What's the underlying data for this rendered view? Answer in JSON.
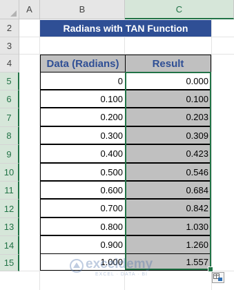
{
  "columns": [
    "A",
    "B",
    "C"
  ],
  "rows": [
    "2",
    "3",
    "4",
    "5",
    "6",
    "7",
    "8",
    "9",
    "10",
    "11",
    "12",
    "13",
    "14",
    "15"
  ],
  "title": "Radians with TAN Function",
  "table": {
    "headers": [
      "Data (Radians)",
      "Result"
    ],
    "rows": [
      {
        "data": "0",
        "result": "0.000"
      },
      {
        "data": "0.100",
        "result": "0.100"
      },
      {
        "data": "0.200",
        "result": "0.203"
      },
      {
        "data": "0.300",
        "result": "0.309"
      },
      {
        "data": "0.400",
        "result": "0.423"
      },
      {
        "data": "0.500",
        "result": "0.546"
      },
      {
        "data": "0.600",
        "result": "0.684"
      },
      {
        "data": "0.700",
        "result": "0.842"
      },
      {
        "data": "0.800",
        "result": "1.030"
      },
      {
        "data": "0.900",
        "result": "1.260"
      },
      {
        "data": "1.000",
        "result": "1.557"
      }
    ]
  },
  "watermark": {
    "brand": "exceldemy",
    "tagline": "EXCEL · DATA · BI"
  },
  "colors": {
    "title_bg": "#2f4f95",
    "header_bg": "#c0c0c0",
    "selection": "#217346"
  }
}
